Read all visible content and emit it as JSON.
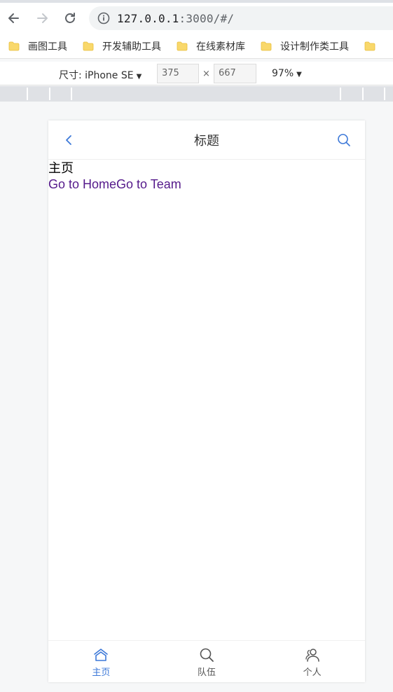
{
  "browser": {
    "url_host": "127.0.0.1",
    "url_rest": ":3000/#/"
  },
  "bookmarks": [
    {
      "label": "画图工具"
    },
    {
      "label": "开发辅助工具"
    },
    {
      "label": "在线素材库"
    },
    {
      "label": "设计制作类工具"
    }
  ],
  "devtools": {
    "device_label": "尺寸: iPhone SE",
    "width": "375",
    "times": "×",
    "height": "667",
    "zoom": "97%"
  },
  "app": {
    "navbar_title": "标题",
    "page_heading": "主页",
    "links": [
      {
        "label": "Go to Home"
      },
      {
        "label": "Go to Team"
      }
    ],
    "tabs": [
      {
        "label": "主页",
        "icon": "home-icon",
        "active": true
      },
      {
        "label": "队伍",
        "icon": "search-icon",
        "active": false
      },
      {
        "label": "个人",
        "icon": "user-icon",
        "active": false
      }
    ],
    "accent_color": "#3c78d8",
    "link_color": "#551a8b"
  }
}
